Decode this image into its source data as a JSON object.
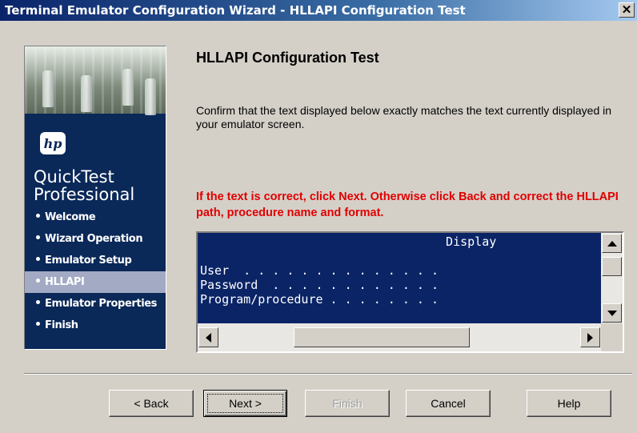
{
  "window": {
    "title": "Terminal Emulator Configuration Wizard - HLLAPI Configuration Test",
    "close_glyph": "✕"
  },
  "sidebar": {
    "logo_text": "hp",
    "product_line1": "QuickTest",
    "product_line2": "Professional",
    "items": [
      {
        "label": "Welcome",
        "active": false
      },
      {
        "label": "Wizard Operation",
        "active": false
      },
      {
        "label": "Emulator Setup",
        "active": false
      },
      {
        "label": "HLLAPI",
        "active": true
      },
      {
        "label": "Emulator Properties",
        "active": false
      },
      {
        "label": "Finish",
        "active": false
      }
    ]
  },
  "main": {
    "heading": "HLLAPI Configuration Test",
    "instruction": "Confirm that the text displayed below exactly matches the text currently displayed in your emulator screen.",
    "warning": "If the text is correct, click Next.  Otherwise click Back and correct the HLLAPI path, procedure name and format.",
    "screen_text": "                                  Display\n\nUser  . . . . . . . . . . . . . .\nPassword  . . . . . . . . . . . .\nProgram/procedure . . . . . . . ."
  },
  "buttons": {
    "back": "< Back",
    "next": "Next >",
    "finish": "Finish",
    "cancel": "Cancel",
    "help": "Help"
  },
  "colors": {
    "warning": "#e00000",
    "screen_bg": "#0a2466",
    "sidebar_bg": "#0a2858",
    "active_item_bg": "#a3aac4"
  }
}
